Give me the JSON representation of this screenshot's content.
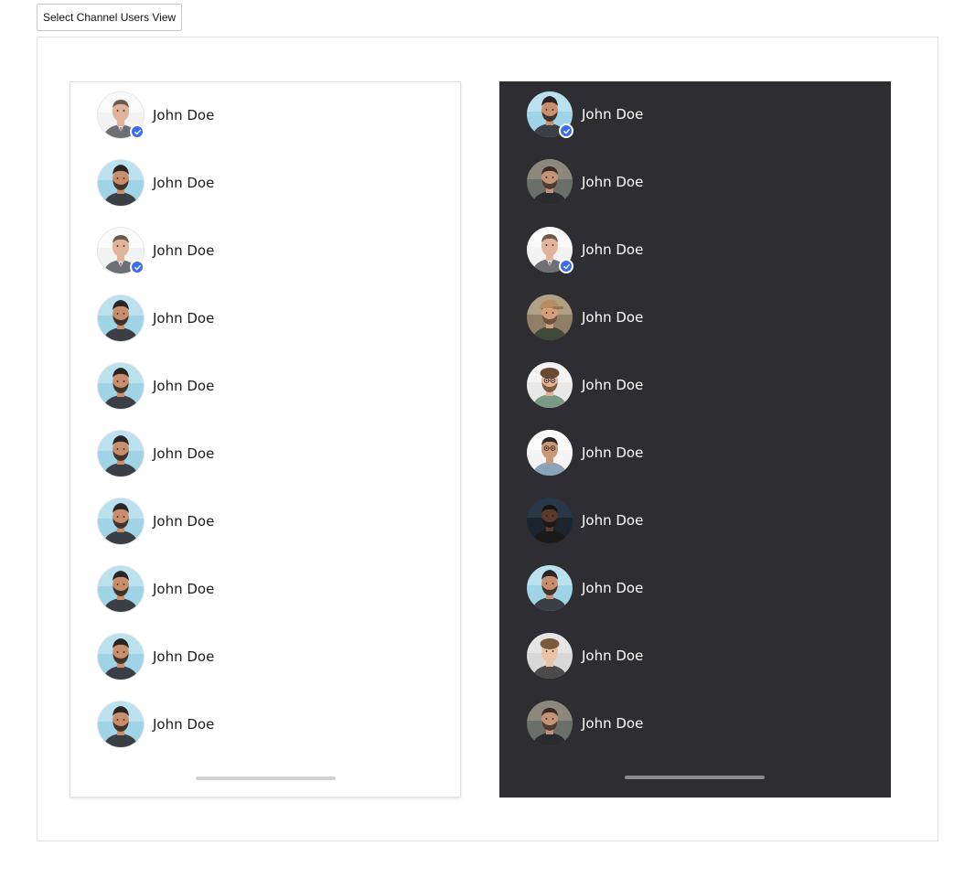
{
  "toolbar": {
    "select_label": "Select Channel Users View"
  },
  "colors": {
    "dark_panel_bg": "#2e2d32",
    "verified_badge": "#3b6cf0",
    "light_text": "#1c1c1e",
    "dark_text": "#ffffff"
  },
  "light_panel": {
    "users": [
      {
        "name": "John Doe",
        "avatar": "man-suit-grey",
        "verified": true
      },
      {
        "name": "John Doe",
        "avatar": "man-blue-bg",
        "verified": false
      },
      {
        "name": "John Doe",
        "avatar": "man-suit-grey",
        "verified": true
      },
      {
        "name": "John Doe",
        "avatar": "man-blue-bg",
        "verified": false
      },
      {
        "name": "John Doe",
        "avatar": "man-blue-bg",
        "verified": false
      },
      {
        "name": "John Doe",
        "avatar": "man-blue-bg",
        "verified": false
      },
      {
        "name": "John Doe",
        "avatar": "man-blue-bg",
        "verified": false
      },
      {
        "name": "John Doe",
        "avatar": "man-blue-bg",
        "verified": false
      },
      {
        "name": "John Doe",
        "avatar": "man-blue-bg",
        "verified": false
      },
      {
        "name": "John Doe",
        "avatar": "man-blue-bg",
        "verified": false
      }
    ]
  },
  "dark_panel": {
    "users": [
      {
        "name": "John Doe",
        "avatar": "man-blue-bg",
        "verified": true
      },
      {
        "name": "John Doe",
        "avatar": "man-bearded-street",
        "verified": false
      },
      {
        "name": "John Doe",
        "avatar": "man-suit-grey",
        "verified": true
      },
      {
        "name": "John Doe",
        "avatar": "man-cap",
        "verified": false
      },
      {
        "name": "John Doe",
        "avatar": "man-curly-glasses",
        "verified": false
      },
      {
        "name": "John Doe",
        "avatar": "man-arms-crossed",
        "verified": false
      },
      {
        "name": "John Doe",
        "avatar": "man-dark-beard",
        "verified": false
      },
      {
        "name": "John Doe",
        "avatar": "man-blue-bg",
        "verified": false
      },
      {
        "name": "John Doe",
        "avatar": "young-man-grey",
        "verified": false
      },
      {
        "name": "John Doe",
        "avatar": "man-bearded-street",
        "verified": false
      }
    ]
  }
}
